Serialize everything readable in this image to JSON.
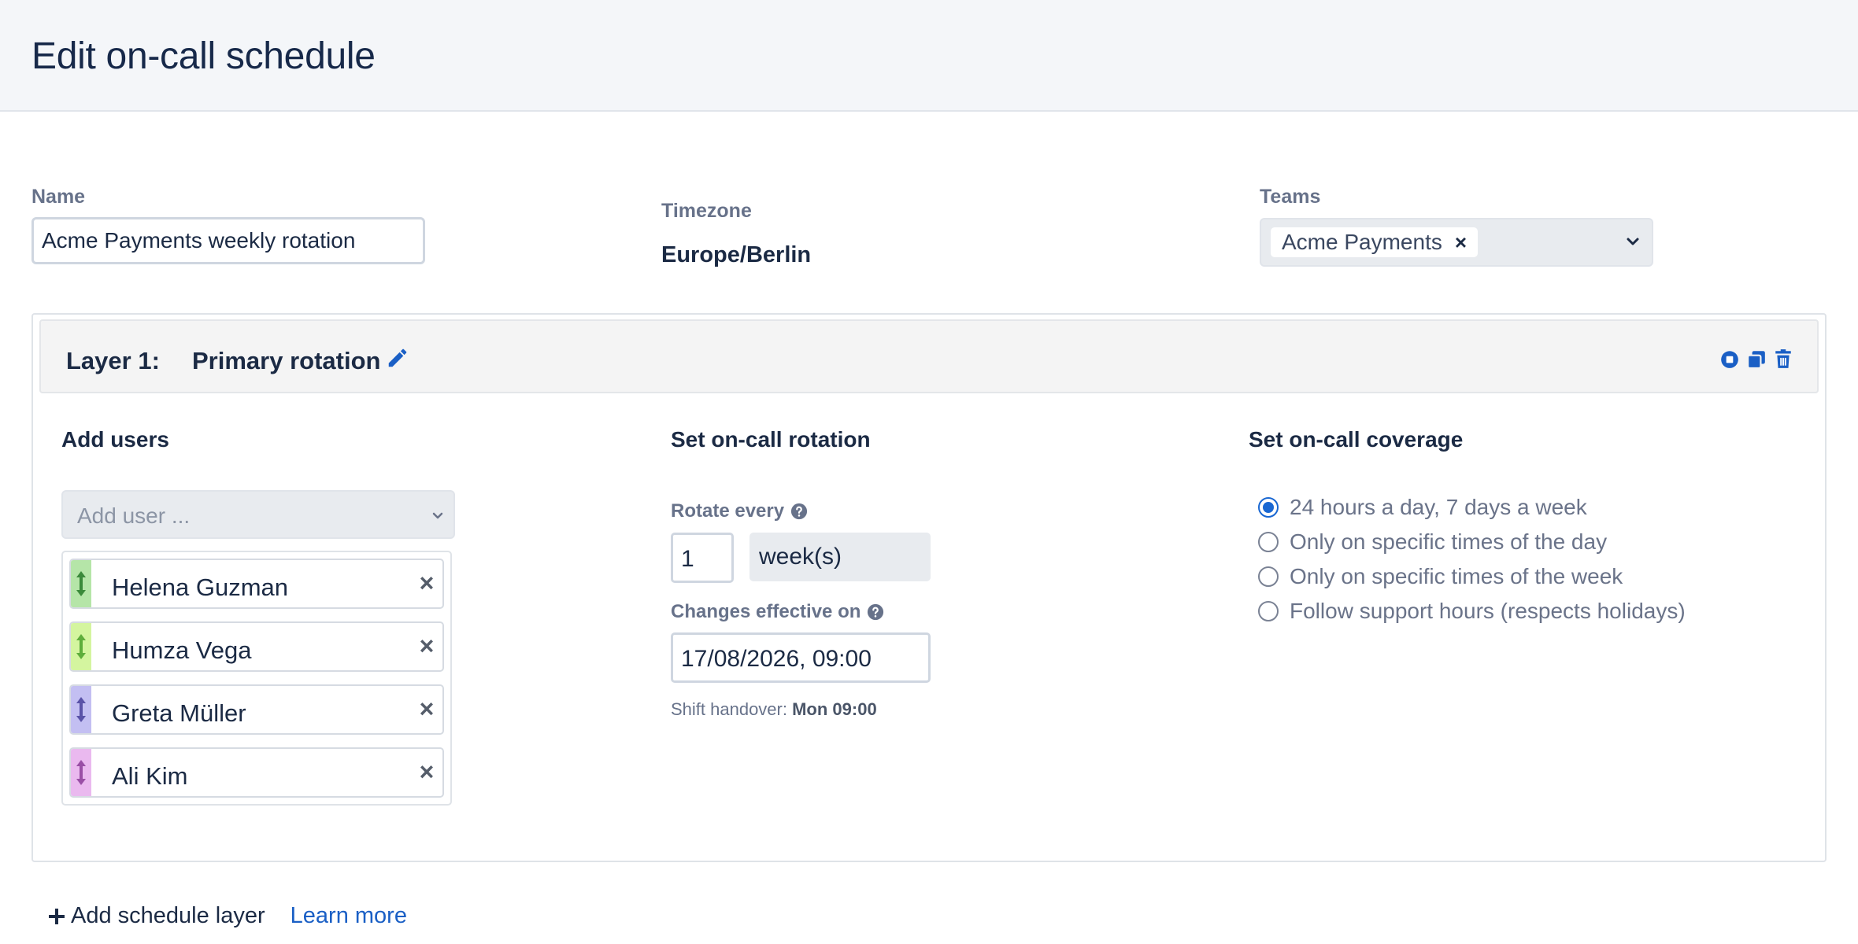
{
  "header": {
    "title": "Edit on-call schedule"
  },
  "form": {
    "name_label": "Name",
    "name_value": "Acme Payments weekly rotation",
    "timezone_label": "Timezone",
    "timezone_value": "Europe/Berlin",
    "teams_label": "Teams",
    "teams_selected": [
      "Acme Payments"
    ]
  },
  "layer": {
    "number_label": "Layer 1:",
    "name": "Primary rotation",
    "actions": [
      "record-icon",
      "copy-icon",
      "trash-icon"
    ],
    "add_users": {
      "title": "Add users",
      "placeholder": "Add user ...",
      "users": [
        {
          "name": "Helena Guzman",
          "color": "#b5e5a8",
          "arrow_color": "#3b8a3b"
        },
        {
          "name": "Humza Vega",
          "color": "#d4f59f",
          "arrow_color": "#5fae3c"
        },
        {
          "name": "Greta Müller",
          "color": "#c3bff2",
          "arrow_color": "#5a53a8"
        },
        {
          "name": "Ali Kim",
          "color": "#eab9ef",
          "arrow_color": "#9a4fa6"
        }
      ]
    },
    "rotation": {
      "title": "Set on-call rotation",
      "rotate_label": "Rotate every",
      "rotate_value": "1",
      "rotate_unit": "week(s)",
      "effective_label": "Changes effective on",
      "effective_value": "17/08/2026, 09:00",
      "handover_prefix": "Shift handover:",
      "handover_value": "Mon 09:00"
    },
    "coverage": {
      "title": "Set on-call coverage",
      "options": [
        {
          "label": "24 hours a day, 7 days a week",
          "checked": true
        },
        {
          "label": "Only on specific times of the day",
          "checked": false
        },
        {
          "label": "Only on specific times of the week",
          "checked": false
        },
        {
          "label": "Follow support hours (respects holidays)",
          "checked": false
        }
      ]
    }
  },
  "footer": {
    "add_layer_label": "Add schedule layer",
    "learn_more_label": "Learn more"
  },
  "colors": {
    "accent": "#1967d2",
    "link": "#1a5fc5",
    "text": "#1b2a44",
    "muted": "#67728a"
  }
}
